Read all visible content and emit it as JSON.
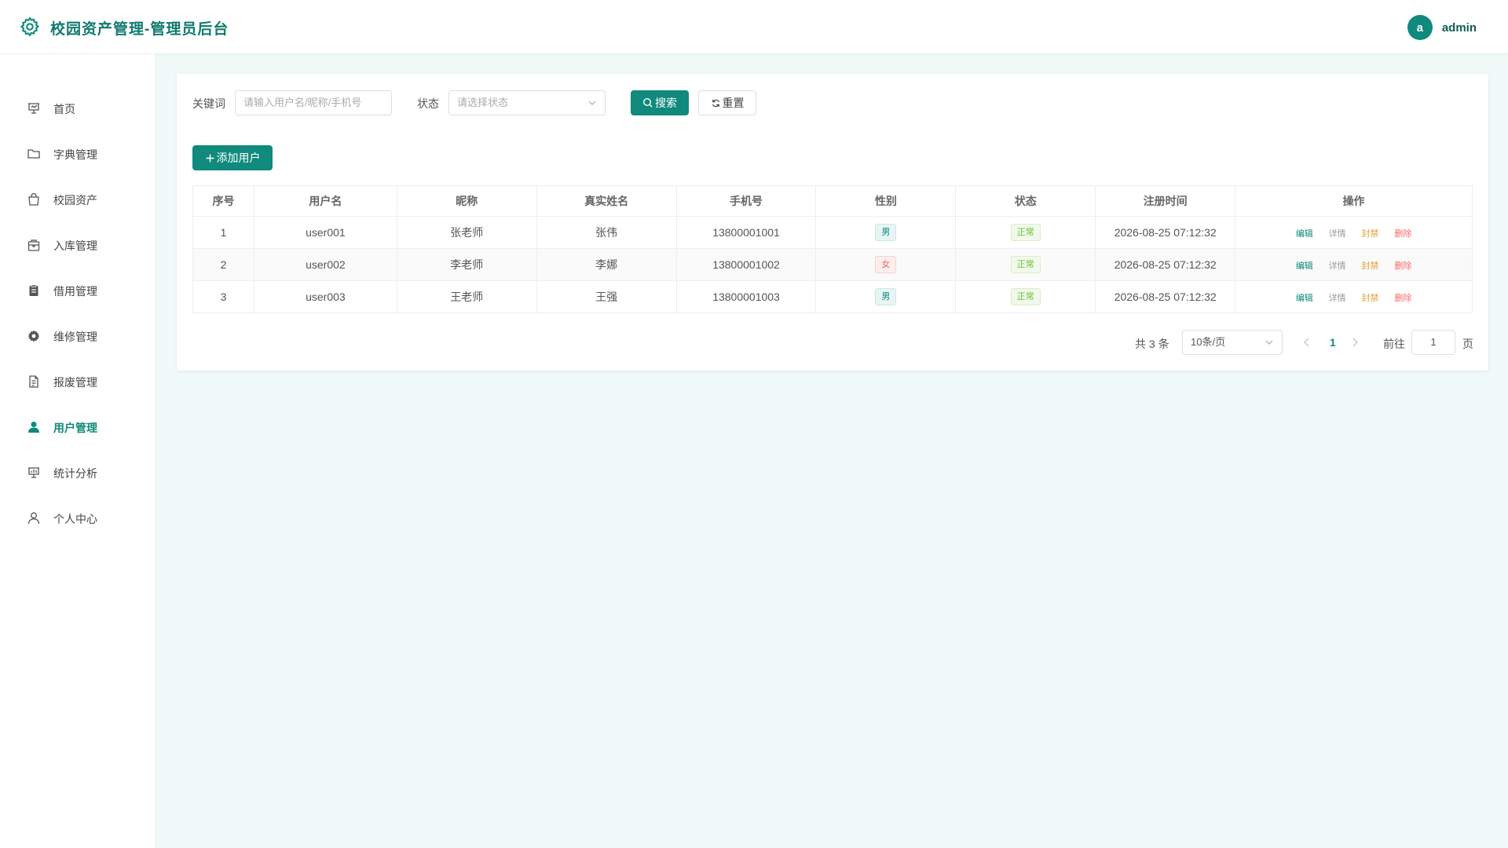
{
  "header": {
    "title": "校园资产管理-管理员后台",
    "avatar_letter": "a",
    "username": "admin"
  },
  "sidebar": {
    "items": [
      {
        "label": "首页",
        "icon": "presentation-icon"
      },
      {
        "label": "字典管理",
        "icon": "folder-icon"
      },
      {
        "label": "校园资产",
        "icon": "bag-icon"
      },
      {
        "label": "入库管理",
        "icon": "box-icon"
      },
      {
        "label": "借用管理",
        "icon": "clipboard-icon"
      },
      {
        "label": "维修管理",
        "icon": "gear-icon"
      },
      {
        "label": "报废管理",
        "icon": "document-icon"
      },
      {
        "label": "用户管理",
        "icon": "user-filled-icon",
        "active": true
      },
      {
        "label": "统计分析",
        "icon": "chart-board-icon"
      },
      {
        "label": "个人中心",
        "icon": "user-outline-icon"
      }
    ]
  },
  "filters": {
    "keyword_label": "关键词",
    "keyword_placeholder": "请输入用户名/昵称/手机号",
    "status_label": "状态",
    "status_placeholder": "请选择状态",
    "search_label": "搜索",
    "reset_label": "重置"
  },
  "toolbar": {
    "add_label": "添加用户"
  },
  "table": {
    "columns": [
      "序号",
      "用户名",
      "昵称",
      "真实姓名",
      "手机号",
      "性别",
      "状态",
      "注册时间",
      "操作"
    ],
    "rows": [
      {
        "index": "1",
        "username": "user001",
        "nickname": "张老师",
        "realname": "张伟",
        "phone": "13800001001",
        "gender": "男",
        "status": "正常",
        "registered": "2026-08-25 07:12:32"
      },
      {
        "index": "2",
        "username": "user002",
        "nickname": "李老师",
        "realname": "李娜",
        "phone": "13800001002",
        "gender": "女",
        "status": "正常",
        "registered": "2026-08-25 07:12:32"
      },
      {
        "index": "3",
        "username": "user003",
        "nickname": "王老师",
        "realname": "王强",
        "phone": "13800001003",
        "gender": "男",
        "status": "正常",
        "registered": "2026-08-25 07:12:32"
      }
    ],
    "actions": {
      "edit": "编辑",
      "detail": "详情",
      "ban": "封禁",
      "delete": "删除"
    }
  },
  "pagination": {
    "total_text": "共 3 条",
    "page_size": "10条/页",
    "current_page": "1",
    "goto_label": "前往",
    "goto_value": "1",
    "page_suffix": "页"
  },
  "colors": {
    "primary": "#0f8a7c",
    "background": "#f0fbf9",
    "male_tag": "#0f8a7c",
    "female_tag": "#e56b6b",
    "status_ok": "#67c23a",
    "ban": "#e6a23c",
    "delete": "#f56c6c"
  }
}
